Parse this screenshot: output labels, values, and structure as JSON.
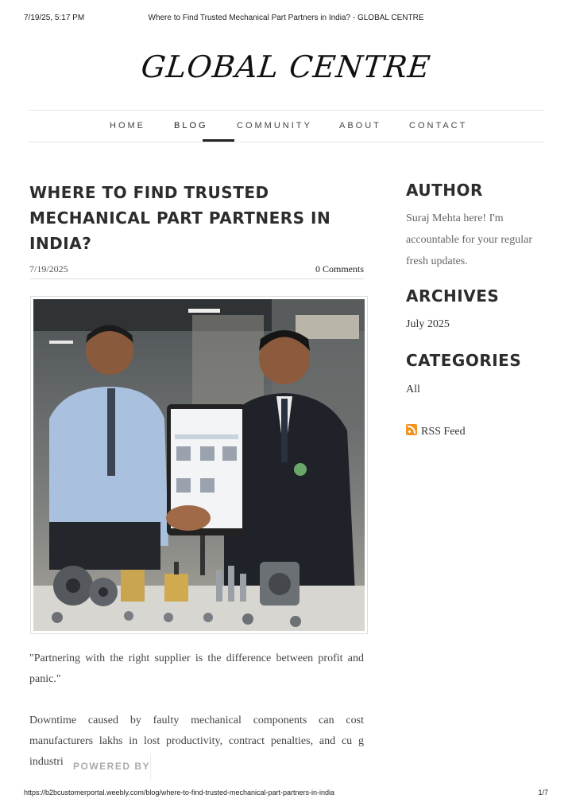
{
  "print_header": {
    "datetime": "7/19/25, 5:17 PM",
    "doc_title": "Where to Find Trusted Mechanical Part Partners in India? - GLOBAL CENTRE"
  },
  "site": {
    "logo_text": "GLOBAL CENTRE"
  },
  "nav": {
    "items": [
      "HOME",
      "BLOG",
      "COMMUNITY",
      "ABOUT",
      "CONTACT"
    ],
    "active": "BLOG"
  },
  "post": {
    "title": "WHERE TO FIND TRUSTED MECHANICAL PART PARTNERS IN INDIA?",
    "date": "7/19/2025",
    "comments": "0 Comments",
    "quote": "\"Partnering with the right supplier is the difference between profit and panic.\"",
    "paragraph": "Downtime caused by faulty mechanical components can cost manufacturers lakhs in lost productivity, contract penalties, and cu                               g industrial ecosystem,"
  },
  "sidebar": {
    "author_heading": "AUTHOR",
    "author_text": "Suraj Mehta here! I'm accountable for your regular fresh updates.",
    "archives_heading": "ARCHIVES",
    "archives_items": [
      "July 2025"
    ],
    "categories_heading": "CATEGORIES",
    "categories_items": [
      "All"
    ],
    "rss_label": "RSS Feed"
  },
  "badge": {
    "powered_by": "POWERED BY"
  },
  "print_footer": {
    "url": "https://b2bcustomerportal.weebly.com/blog/where-to-find-trusted-mechanical-part-partners-in-india",
    "page": "1/7"
  },
  "colors": {
    "rss_orange": "#f39422",
    "text_dark": "#2c2c2c"
  }
}
